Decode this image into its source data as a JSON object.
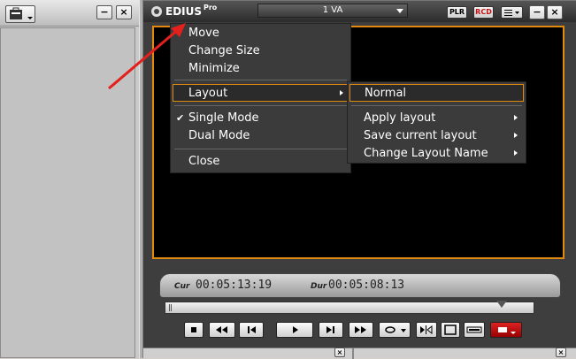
{
  "player": {
    "logo_text": "EDIUS",
    "logo_sup": "Pro",
    "track_value": "1 VA",
    "plr_label": "PLR",
    "rcd_label": "RCD",
    "minimize_label": "−",
    "close_label": "×",
    "cur_label": "Cur",
    "cur_value": "00:05:13:19",
    "dur_label": "Dur",
    "dur_value": "00:05:08:13"
  },
  "window_menu": {
    "items": [
      {
        "label": "Move"
      },
      {
        "label": "Change Size"
      },
      {
        "label": "Minimize"
      },
      {
        "label": "Layout"
      },
      {
        "label": "Single Mode",
        "checked": true
      },
      {
        "label": "Dual Mode"
      },
      {
        "label": "Close"
      }
    ]
  },
  "layout_submenu": {
    "items": [
      {
        "label": "Normal"
      },
      {
        "label": "Apply layout"
      },
      {
        "label": "Save current layout"
      },
      {
        "label": "Change Layout Name"
      }
    ]
  },
  "checkmark": "✔",
  "colors": {
    "accent_orange": "#e08a10",
    "arrow_red": "#e5201c",
    "menu_bg": "#3b3b3b"
  }
}
